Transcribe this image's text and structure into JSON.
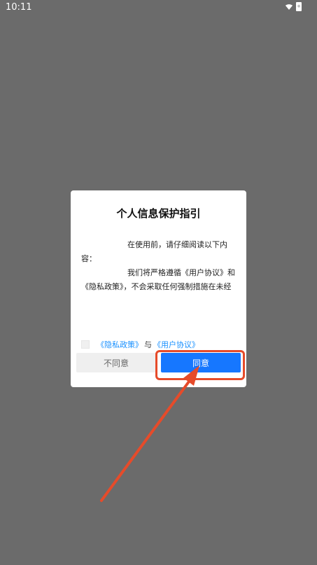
{
  "status_bar": {
    "time": "10:11"
  },
  "dialog": {
    "title": "个人信息保护指引",
    "content_line1": "在使用前，请仔细阅读以下内容：",
    "content_line2": "我们将严格遵循《用户协议》和《隐私政策》，不会采取任何强制措施在未经",
    "agreement_link_privacy": "《隐私政策》",
    "agreement_connector": "与",
    "agreement_link_user": "《用户协议》",
    "button_disagree": "不同意",
    "button_agree": "同意"
  },
  "colors": {
    "background": "#6b6b6b",
    "link": "#1890ff",
    "agree_button": "#1677ff",
    "annotation": "#e64b2a"
  },
  "icons": {
    "wifi": "wifi-icon",
    "battery": "battery-icon",
    "checkbox": "checkbox-unchecked"
  }
}
